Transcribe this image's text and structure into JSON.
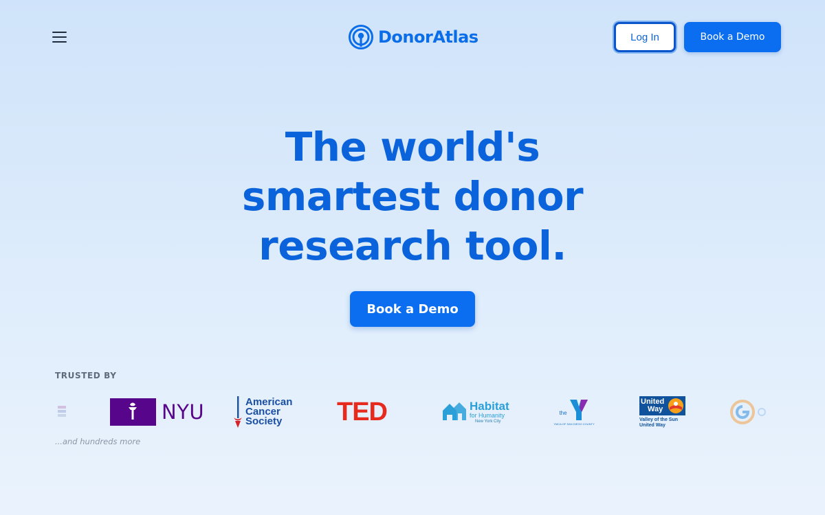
{
  "header": {
    "brand_name": "DonorAtlas",
    "login_label": "Log In",
    "book_demo_label": "Book a Demo"
  },
  "hero": {
    "title_lines": [
      "The world's",
      "smartest donor",
      "research tool."
    ],
    "cta_label": "Book a Demo"
  },
  "trusted": {
    "label": "TRUSTED BY",
    "more_text": "...and hundreds more",
    "logos": {
      "nyu": {
        "text": "NYU"
      },
      "acs": {
        "line1": "American",
        "line2": "Cancer",
        "line3": "Society"
      },
      "ted": {
        "text": "TED"
      },
      "habitat": {
        "line1": "Habitat",
        "line2": "for Humanity",
        "line3": "New York City"
      },
      "ymca": {
        "small": "the",
        "sub": "YMCA OF SAN DIEGO COUNTY"
      },
      "united_way": {
        "line1": "United",
        "line2": "Way",
        "line3": "Valley of the Sun",
        "line4": "United Way"
      }
    }
  },
  "colors": {
    "brand_blue": "#0b6ef0",
    "heading_blue": "#0b63dc",
    "nyu_purple": "#57068c",
    "ted_red": "#e62b1e",
    "habitat_teal": "#2a9fd8",
    "united_way_blue": "#10529c"
  }
}
